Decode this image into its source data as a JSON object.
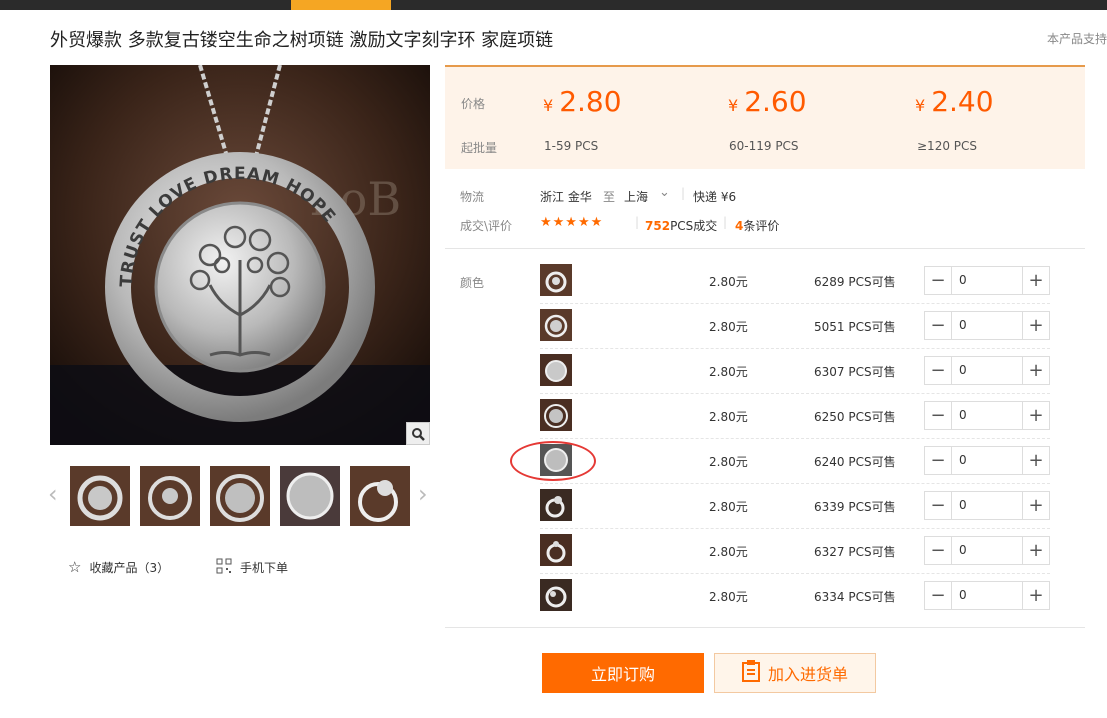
{
  "product": {
    "title": "外贸爆款 多款复古镂空生命之树项链 激励文字刻字环 家庭项链",
    "support_note": "本产品支持",
    "pendant_text": "TRUST LOVE DREAM HOPE"
  },
  "gallery": {
    "favorite_label": "收藏产品（3）",
    "mobile_order_label": "手机下单"
  },
  "pricing": {
    "price_label": "价格",
    "qty_label": "起批量",
    "currency": "¥",
    "tiers": [
      {
        "price": "2.80",
        "range": "1-59  PCS"
      },
      {
        "price": "2.60",
        "range": "60-119  PCS"
      },
      {
        "price": "2.40",
        "range": "≥120  PCS"
      }
    ]
  },
  "logistics": {
    "label": "物流",
    "origin": "浙江 金华",
    "to": "至",
    "destination": "上海",
    "shipping": "快递 ¥6"
  },
  "reviews": {
    "label": "成交\\评价",
    "stars": "★★★★★",
    "deals_count": "752",
    "deals_suffix": "PCS成交",
    "review_count": "4",
    "review_suffix": "条评价"
  },
  "variants": {
    "label": "颜色",
    "items": [
      {
        "price": "2.80元",
        "stock": "6289 PCS可售",
        "qty": "0"
      },
      {
        "price": "2.80元",
        "stock": "5051 PCS可售",
        "qty": "0"
      },
      {
        "price": "2.80元",
        "stock": "6307 PCS可售",
        "qty": "0"
      },
      {
        "price": "2.80元",
        "stock": "6250 PCS可售",
        "qty": "0"
      },
      {
        "price": "2.80元",
        "stock": "6240 PCS可售",
        "qty": "0"
      },
      {
        "price": "2.80元",
        "stock": "6339 PCS可售",
        "qty": "0"
      },
      {
        "price": "2.80元",
        "stock": "6327 PCS可售",
        "qty": "0"
      },
      {
        "price": "2.80元",
        "stock": "6334 PCS可售",
        "qty": "0"
      }
    ]
  },
  "buttons": {
    "buy_now": "立即订购",
    "add_to_cart": "加入进货单"
  },
  "colors": {
    "accent": "#ff6a00",
    "price": "#ff5a00",
    "nav_active": "#f5a623"
  }
}
